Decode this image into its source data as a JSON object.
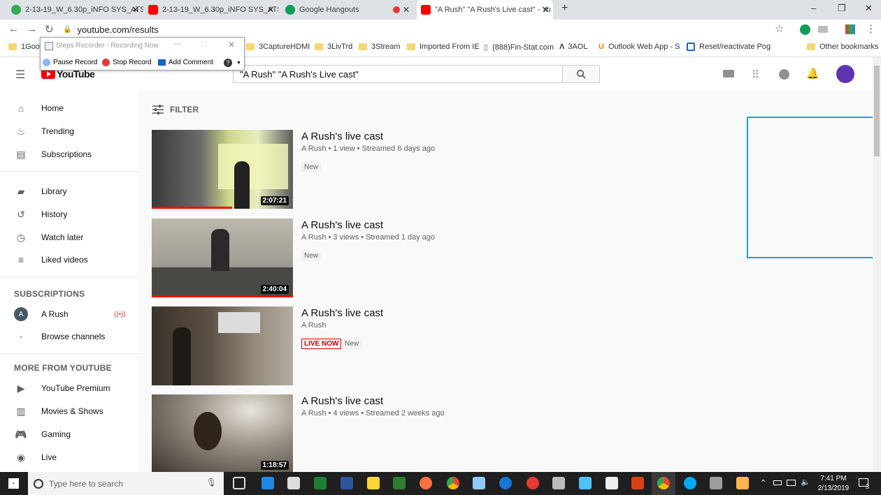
{
  "browser": {
    "tabs": [
      {
        "title": "2-13-19_W_6.30p_iNFO SYS_ATS",
        "color": "#34a853"
      },
      {
        "title": "2-13-19_W_6.30p_iNFO SYS_ATS",
        "color": "#ff0000"
      },
      {
        "title": "Google Hangouts",
        "color": "#0f9d58"
      },
      {
        "title": "\"A Rush\" \"A Rush's Live cast\" - Yo",
        "color": "#ff0000"
      }
    ],
    "url": "youtube.com/results",
    "bookmarks": [
      "1Goo",
      "3CaptureHDMI",
      "3LivTrd",
      "3Stream",
      "Imported From IE",
      "(888)Fin-Stat.com",
      "3AOL",
      "Outlook Web App - S",
      "Reset/reactivate Pog",
      "Other bookmarks"
    ]
  },
  "steps_recorder": {
    "title": "Steps Recorder - Recording Now",
    "pause": "Pause Record",
    "stop": "Stop Record",
    "comment": "Add Comment"
  },
  "youtube": {
    "logo": "YouTube",
    "search_value": "\"A Rush\" \"A Rush's Live cast\"",
    "filter": "FILTER",
    "sidebar": {
      "main": [
        "Home",
        "Trending",
        "Subscriptions"
      ],
      "library": [
        "Library",
        "History",
        "Watch later",
        "Liked videos"
      ],
      "subs_head": "SUBSCRIPTIONS",
      "subs": [
        "A Rush",
        "Browse channels"
      ],
      "avatar_letter": "A",
      "more_head": "MORE FROM YOUTUBE",
      "more": [
        "YouTube Premium",
        "Movies & Shows",
        "Gaming",
        "Live"
      ]
    },
    "videos": [
      {
        "title": "A Rush's live cast",
        "meta": "A Rush • 1 view • Streamed 6 days ago",
        "badge": "New",
        "live": "",
        "duration": "2:07:21",
        "watched": 0.57
      },
      {
        "title": "A Rush's live cast",
        "meta": "A Rush • 3 views • Streamed 1 day ago",
        "badge": "New",
        "live": "",
        "duration": "2:40:04",
        "watched": 1.0
      },
      {
        "title": "A Rush's live cast",
        "meta": "A Rush",
        "badge": "New",
        "live": "LIVE NOW",
        "duration": "",
        "watched": 0
      },
      {
        "title": "A Rush's live cast",
        "meta": "A Rush • 4 views • Streamed 2 weeks ago",
        "badge": "",
        "live": "",
        "duration": "1:18:57",
        "watched": 0
      }
    ]
  },
  "taskbar": {
    "search_placeholder": "Type here to search",
    "time": "7:41 PM",
    "date": "2/13/2019",
    "notifications": "3"
  }
}
